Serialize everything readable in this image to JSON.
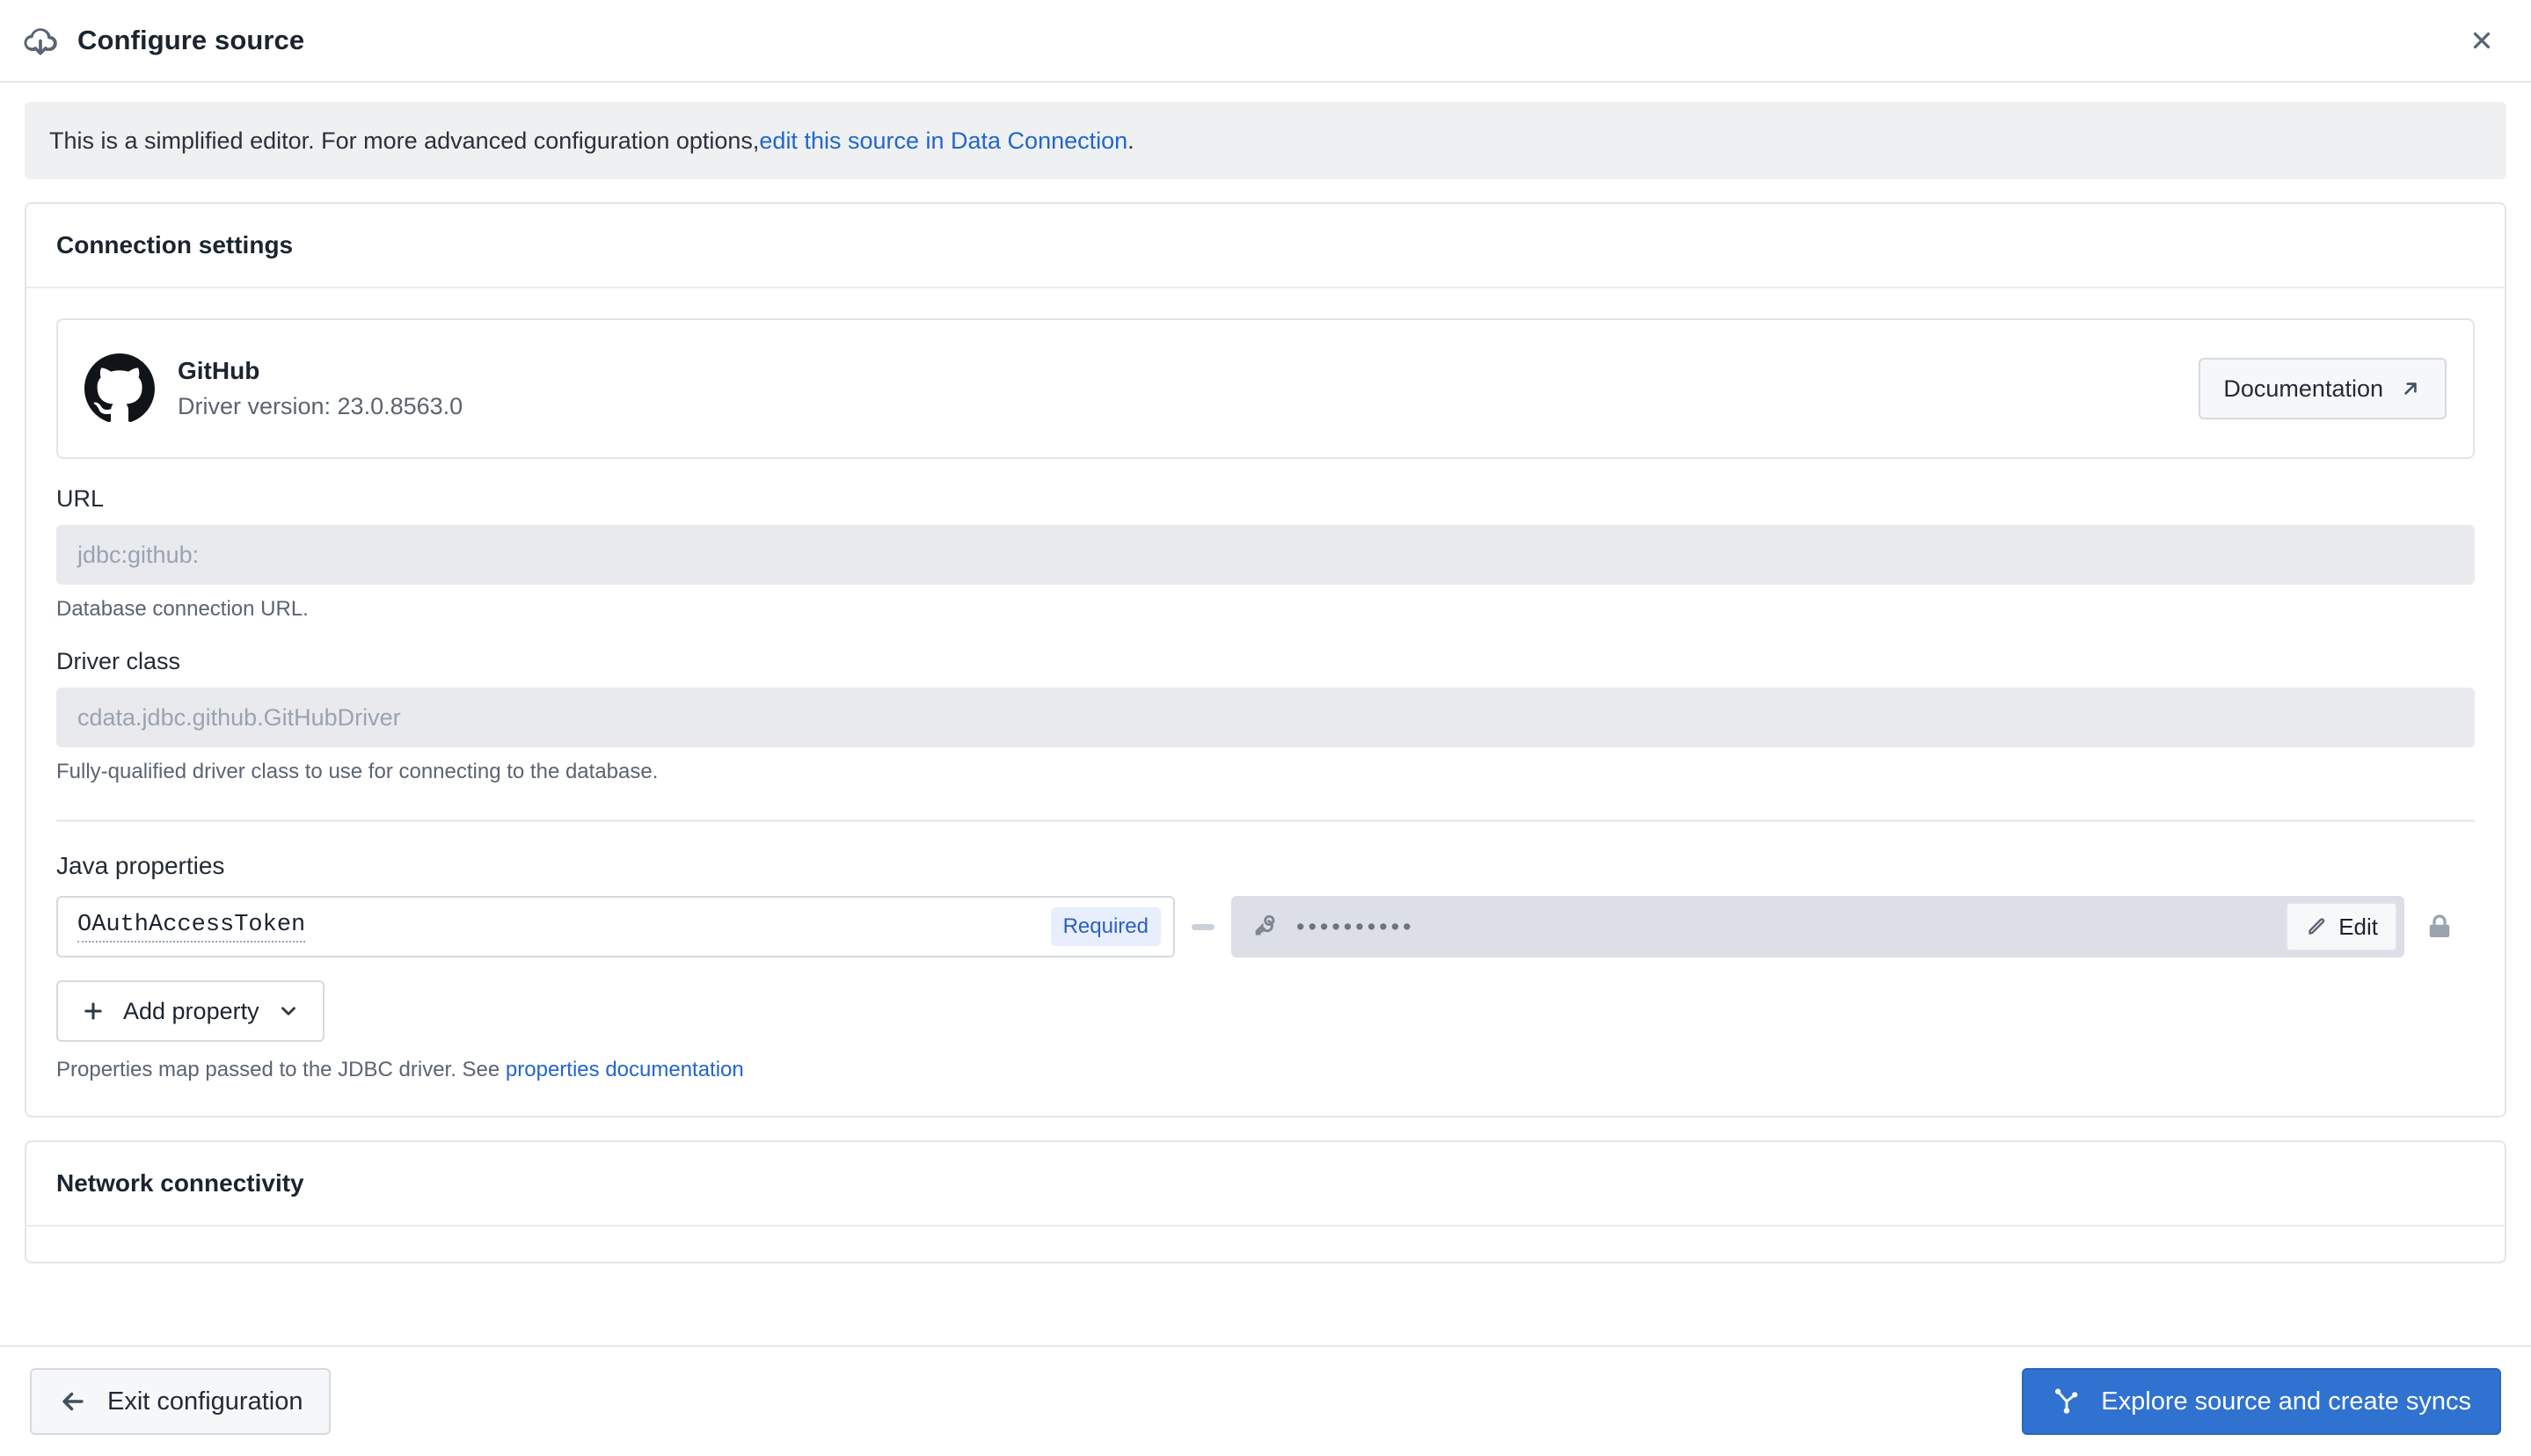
{
  "window": {
    "title": "Configure source",
    "title_icon": "cloud-download-icon",
    "close_icon": "close-icon"
  },
  "notice": {
    "text_before": "This is a simplified editor. For more advanced configuration options, ",
    "link_text": "edit this source in Data Connection",
    "text_after": "."
  },
  "connection_settings": {
    "heading": "Connection settings",
    "driver": {
      "logo_icon": "github-logo-icon",
      "name": "GitHub",
      "version": "Driver version: 23.0.8563.0",
      "doc_button_label": "Documentation",
      "doc_button_icon": "external-link-arrow-icon"
    },
    "url_field": {
      "label": "URL",
      "value": "",
      "placeholder": "jdbc:github:",
      "help": "Database connection URL."
    },
    "driver_class_field": {
      "label": "Driver class",
      "value": "",
      "placeholder": "cdata.jdbc.github.GitHubDriver",
      "help": "Fully-qualified driver class to use for connecting to the database."
    },
    "java_properties": {
      "label": "Java properties",
      "rows": [
        {
          "key": "OAuthAccessToken",
          "badge": "Required",
          "separator": "—",
          "value_icon": "key-icon",
          "value_masked": "••••••••••",
          "edit_label": "Edit",
          "edit_icon": "pencil-icon",
          "lock_icon": "lock-icon"
        }
      ],
      "add_button_label": "Add property",
      "add_button_icon": "plus-icon",
      "add_button_caret": "chevron-down-icon",
      "help_before": "Properties map passed to the JDBC driver. See ",
      "help_link": "properties documentation"
    }
  },
  "network_connectivity": {
    "heading": "Network connectivity"
  },
  "footer": {
    "exit_label": "Exit configuration",
    "exit_icon": "arrow-left-icon",
    "explore_label": "Explore source and create syncs",
    "explore_icon": "sitemap-icon"
  },
  "colors": {
    "accent": "#3072cf",
    "link": "#2266cc",
    "badge_bg": "#e8eefb",
    "badge_text": "#2b5fc4",
    "notice_bg": "#eef0f2",
    "disabled_input_bg": "#e8eaee"
  }
}
